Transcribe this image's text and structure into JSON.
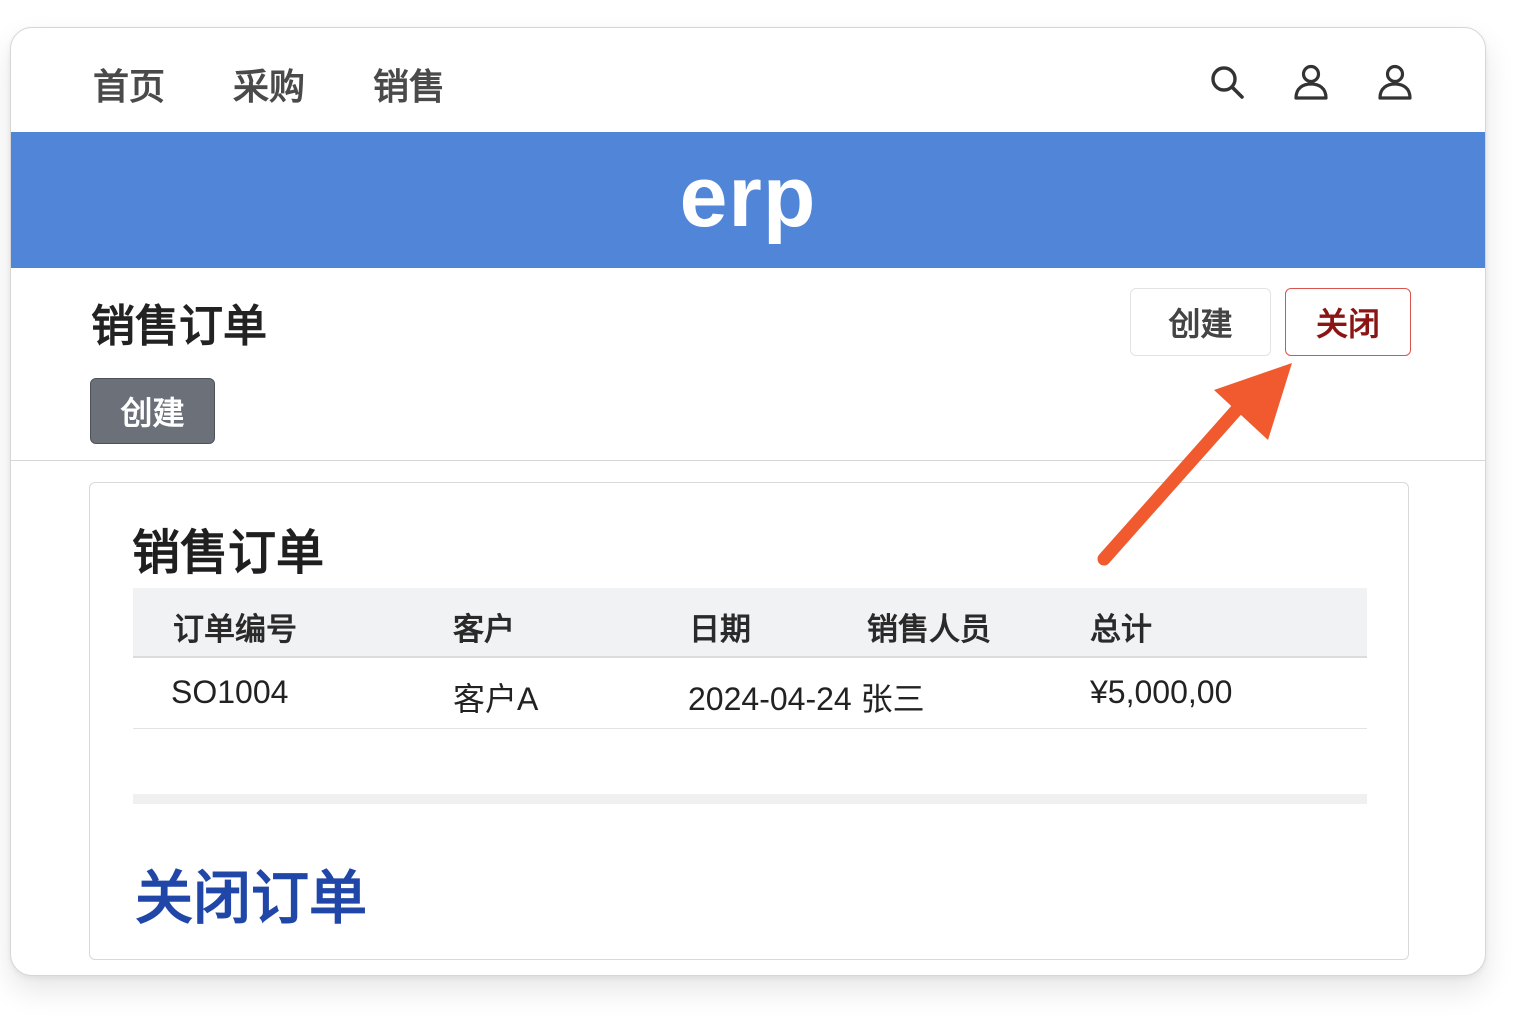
{
  "nav": {
    "links": [
      "首页",
      "采购",
      "销售"
    ],
    "icons": [
      "search-icon",
      "user-icon",
      "user-icon"
    ]
  },
  "banner": {
    "brand": "erp"
  },
  "header": {
    "title": "销售订单",
    "create_label": "创建",
    "close_label": "关闭",
    "secondary_create_label": "创建"
  },
  "card": {
    "title": "销售订单",
    "columns": [
      "订单编号",
      "客户",
      "日期",
      "销售人员",
      "总计"
    ],
    "rows": [
      {
        "order_no": "SO1004",
        "customer": "客户A",
        "date_sales": "2024-04-24 张三",
        "total": "¥5,000,00"
      }
    ],
    "close_order_label": "关闭订单"
  },
  "colors": {
    "banner": "#5085d8",
    "close_border": "#d9534f",
    "close_text": "#8b1414",
    "link_blue": "#2047a8",
    "arrow": "#f05a2e",
    "secondary_button": "#6b7079"
  }
}
